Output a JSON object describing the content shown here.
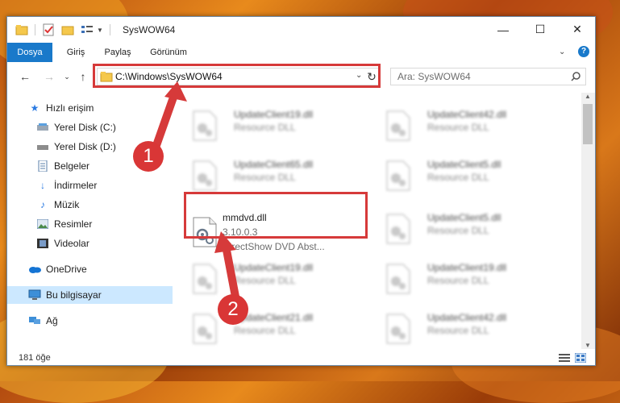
{
  "window": {
    "title": "SysWOW64",
    "controls": {
      "minimize": "—",
      "maximize": "☐",
      "close": "✕"
    }
  },
  "ribbon": {
    "tabs": [
      "Dosya",
      "Giriş",
      "Paylaş",
      "Görünüm"
    ],
    "help": "?"
  },
  "navigation": {
    "address": "C:\\Windows\\SysWOW64",
    "search_placeholder": "Ara: SysWOW64"
  },
  "sidebar": {
    "items": [
      {
        "label": "Hızlı erişim",
        "icon": "star-icon"
      },
      {
        "label": "Yerel Disk (C:)",
        "icon": "drive-icon"
      },
      {
        "label": "Yerel Disk (D:)",
        "icon": "drive-icon"
      },
      {
        "label": "Belgeler",
        "icon": "documents-icon"
      },
      {
        "label": "İndirmeler",
        "icon": "download-icon"
      },
      {
        "label": "Müzik",
        "icon": "music-icon"
      },
      {
        "label": "Resimler",
        "icon": "pictures-icon"
      },
      {
        "label": "Videolar",
        "icon": "videos-icon"
      },
      {
        "label": "OneDrive",
        "icon": "cloud-icon"
      },
      {
        "label": "Bu bilgisayar",
        "icon": "computer-icon"
      },
      {
        "label": "Ağ",
        "icon": "network-icon"
      }
    ]
  },
  "files": {
    "left": [
      {
        "name": "UpdateClient19.dll",
        "desc": "Resource DLL"
      },
      {
        "name": "UpdateClient65.dll",
        "desc": "Resource DLL"
      },
      {
        "name": "mmdvd.dll",
        "version": "3.10.0.3",
        "desc": "DirectShow DVD Abst..."
      },
      {
        "name": "UpdateClient19.dll",
        "desc": "Resource DLL"
      },
      {
        "name": "UpdateClient21.dll",
        "desc": "Resource DLL"
      }
    ],
    "right": [
      {
        "name": "UpdateClient42.dll",
        "desc": "Resource DLL"
      },
      {
        "name": "UpdateClient5.dll",
        "desc": "Resource DLL"
      },
      {
        "name": "UpdateClient5.dll",
        "desc": "Resource DLL"
      },
      {
        "name": "UpdateClient19.dll",
        "desc": "Resource DLL"
      },
      {
        "name": "UpdateClient42.dll",
        "desc": "Resource DLL"
      }
    ]
  },
  "status": {
    "count": "181 öğe"
  },
  "annotations": {
    "step1": "1",
    "step2": "2",
    "color": "#d63a3a"
  }
}
